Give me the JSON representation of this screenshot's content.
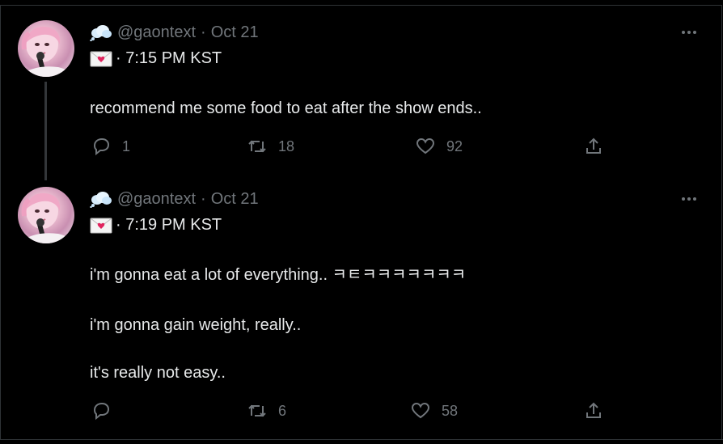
{
  "tweets": [
    {
      "handle": "@gaontext",
      "sep": "·",
      "date": "Oct 21",
      "time": "· 7:15 PM KST",
      "text": "recommend me some food to eat after the show ends..",
      "replies": "1",
      "retweets": "18",
      "likes": "92"
    },
    {
      "handle": "@gaontext",
      "sep": "·",
      "date": "Oct 21",
      "time": "· 7:19 PM KST",
      "text_lines": [
        "i'm gonna eat a lot of everything.. ㅋㅌㅋㅋㅋㅋㅋㅋㅋ",
        "i'm gonna gain weight, really..",
        "it's really not easy.."
      ],
      "replies": "",
      "retweets": "6",
      "likes": "58"
    }
  ],
  "icons": [
    "cloud-icon",
    "envelope-icon",
    "more-icon",
    "reply-icon",
    "retweet-icon",
    "like-icon",
    "share-icon"
  ],
  "colors": {
    "background": "#000000",
    "text": "#e7e9ea",
    "muted": "#71767b",
    "border": "#2f3336"
  }
}
